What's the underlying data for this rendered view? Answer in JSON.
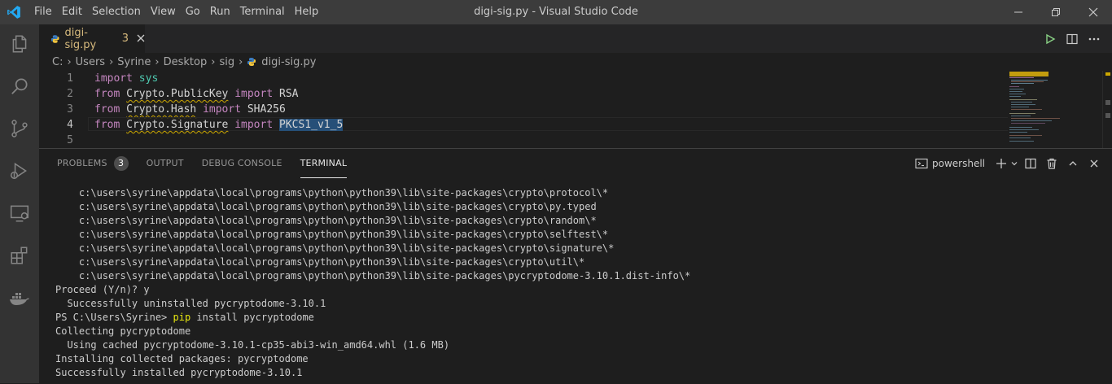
{
  "menu": [
    "File",
    "Edit",
    "Selection",
    "View",
    "Go",
    "Run",
    "Terminal",
    "Help"
  ],
  "window_title": "digi-sig.py - Visual Studio Code",
  "tab": {
    "label": "digi-sig.py",
    "count": "3"
  },
  "breadcrumb": [
    "C:",
    "Users",
    "Syrine",
    "Desktop",
    "sig",
    "digi-sig.py"
  ],
  "editor": {
    "lines": [
      {
        "num": "1",
        "tokens": [
          {
            "t": "import",
            "c": "kw"
          },
          {
            "t": " ",
            "c": "id"
          },
          {
            "t": "sys",
            "c": "mod"
          }
        ]
      },
      {
        "num": "2",
        "tokens": [
          {
            "t": "from",
            "c": "kw"
          },
          {
            "t": " ",
            "c": "id"
          },
          {
            "t": "Crypto.PublicKey",
            "c": "id",
            "u": true
          },
          {
            "t": " ",
            "c": "id"
          },
          {
            "t": "import",
            "c": "kw"
          },
          {
            "t": " RSA",
            "c": "id"
          }
        ]
      },
      {
        "num": "3",
        "tokens": [
          {
            "t": "from",
            "c": "kw"
          },
          {
            "t": " ",
            "c": "id"
          },
          {
            "t": "Crypto.Hash",
            "c": "id",
            "u": true
          },
          {
            "t": " ",
            "c": "id"
          },
          {
            "t": "import",
            "c": "kw"
          },
          {
            "t": " SHA256",
            "c": "id"
          }
        ]
      },
      {
        "num": "4",
        "active": true,
        "tokens": [
          {
            "t": "from",
            "c": "kw"
          },
          {
            "t": " ",
            "c": "id"
          },
          {
            "t": "Crypto.Signature",
            "c": "id",
            "u": true
          },
          {
            "t": " ",
            "c": "id"
          },
          {
            "t": "import",
            "c": "kw"
          },
          {
            "t": " ",
            "c": "id"
          },
          {
            "t": "PKCS1_v1_5",
            "c": "id",
            "sel": true
          }
        ]
      },
      {
        "num": "5",
        "tokens": []
      }
    ]
  },
  "panel": {
    "tabs": [
      {
        "label": "PROBLEMS",
        "badge": "3"
      },
      {
        "label": "OUTPUT"
      },
      {
        "label": "DEBUG CONSOLE"
      },
      {
        "label": "TERMINAL",
        "active": true
      }
    ],
    "shell_label": "powershell"
  },
  "terminal": {
    "lines": [
      {
        "text": "    c:\\users\\syrine\\appdata\\local\\programs\\python\\python39\\lib\\site-packages\\crypto\\protocol\\*"
      },
      {
        "text": "    c:\\users\\syrine\\appdata\\local\\programs\\python\\python39\\lib\\site-packages\\crypto\\py.typed"
      },
      {
        "text": "    c:\\users\\syrine\\appdata\\local\\programs\\python\\python39\\lib\\site-packages\\crypto\\random\\*"
      },
      {
        "text": "    c:\\users\\syrine\\appdata\\local\\programs\\python\\python39\\lib\\site-packages\\crypto\\selftest\\*"
      },
      {
        "text": "    c:\\users\\syrine\\appdata\\local\\programs\\python\\python39\\lib\\site-packages\\crypto\\signature\\*"
      },
      {
        "text": "    c:\\users\\syrine\\appdata\\local\\programs\\python\\python39\\lib\\site-packages\\crypto\\util\\*"
      },
      {
        "text": "    c:\\users\\syrine\\appdata\\local\\programs\\python\\python39\\lib\\site-packages\\pycryptodome-3.10.1.dist-info\\*"
      },
      {
        "text": "Proceed (Y/n)? y"
      },
      {
        "text": "  Successfully uninstalled pycryptodome-3.10.1"
      },
      {
        "prompt": "PS C:\\Users\\Syrine> ",
        "cmd": "pip",
        "args": " install pycryptodome"
      },
      {
        "text": "Collecting pycryptodome"
      },
      {
        "text": "  Using cached pycryptodome-3.10.1-cp35-abi3-win_amd64.whl (1.6 MB)"
      },
      {
        "text": "Installing collected packages: pycryptodome"
      },
      {
        "text": "Successfully installed pycryptodome-3.10.1"
      }
    ]
  },
  "colors": {
    "accent": "#007acc",
    "keyword": "#c586c0",
    "module": "#4ec9b0",
    "warning": "#cca700",
    "selection": "#264f78",
    "command": "#e5e510"
  }
}
